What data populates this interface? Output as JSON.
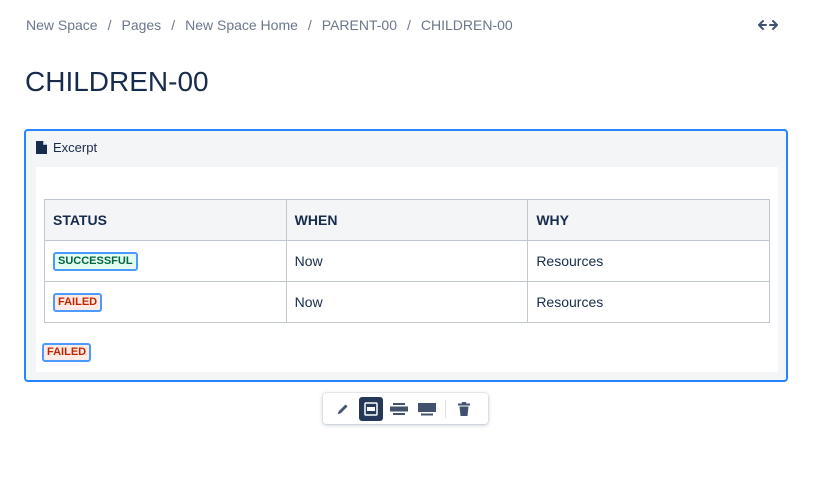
{
  "breadcrumbs": [
    "New Space",
    "Pages",
    "New Space Home",
    "PARENT-00",
    "CHILDREN-00"
  ],
  "breadcrumb_separator": "/",
  "header": {
    "fullwidth_icon": "expand-horizontal-icon"
  },
  "page": {
    "title": "CHILDREN-00"
  },
  "excerpt": {
    "label": "Excerpt",
    "icon": "document-icon",
    "table": {
      "columns": [
        "STATUS",
        "WHEN",
        "WHY"
      ],
      "rows": [
        {
          "status": "SUCCESSFUL",
          "status_type": "success",
          "when": "Now",
          "why": "Resources"
        },
        {
          "status": "FAILED",
          "status_type": "failed",
          "when": "Now",
          "why": "Resources"
        }
      ]
    },
    "standalone_status": "FAILED"
  },
  "toolbar": {
    "items": [
      "edit-icon",
      "layout-center-icon",
      "layout-wide-icon",
      "layout-full-width-icon",
      "delete-icon"
    ],
    "active": "layout-center-icon"
  },
  "colors": {
    "selection_border": "#2684ff",
    "success_text": "#006644",
    "failed_text": "#bf2600",
    "toolbar_active": "#253858"
  }
}
